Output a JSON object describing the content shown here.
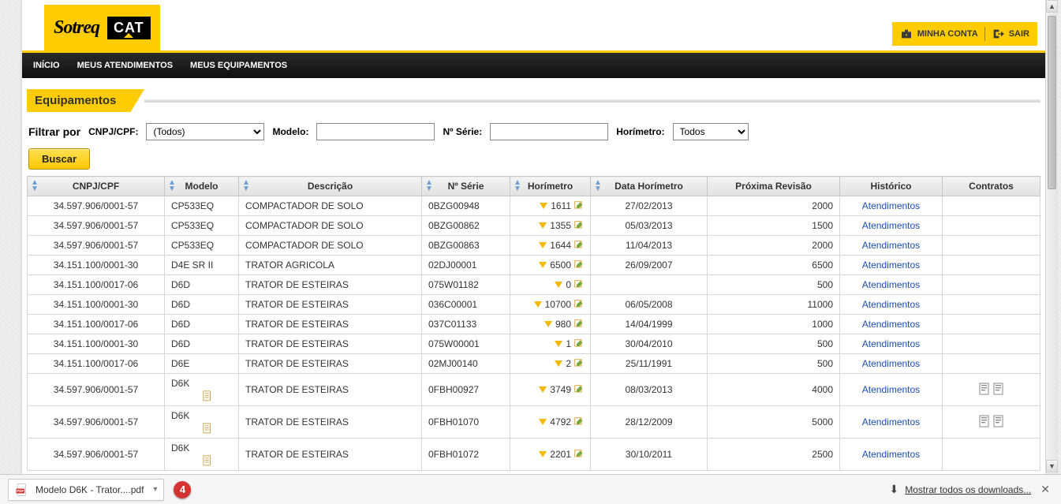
{
  "brand": {
    "name": "Sotreq",
    "partner": "CAT"
  },
  "account": {
    "my_account": "MINHA CONTA",
    "logout": "SAIR"
  },
  "nav": {
    "home": "INÍCIO",
    "atend": "MEUS ATENDIMENTOS",
    "equip": "MEUS EQUIPAMENTOS"
  },
  "section_title": "Equipamentos",
  "filters": {
    "filter_by": "Filtrar por",
    "cnpj_label": "CNPJ/CPF:",
    "cnpj_value": "(Todos)",
    "modelo_label": "Modelo:",
    "modelo_value": "",
    "serie_label": "Nº Série:",
    "serie_value": "",
    "hori_label": "Horímetro:",
    "hori_value": "Todos",
    "buscar": "Buscar"
  },
  "columns": {
    "cnpj": "CNPJ/CPF",
    "modelo": "Modelo",
    "descricao": "Descrição",
    "serie": "Nº Série",
    "horimetro": "Horímetro",
    "data_hori": "Data Horímetro",
    "prox_rev": "Próxima Revisão",
    "historico": "Histórico",
    "contratos": "Contratos"
  },
  "link_label": "Atendimentos",
  "rows": [
    {
      "cnpj": "34.597.906/0001-57",
      "modelo": "CP533EQ",
      "desc": "COMPACTADOR DE SOLO",
      "serie": "0BZG00948",
      "hori": "1611",
      "data": "27/02/2013",
      "prox": "2000",
      "hist": true,
      "contr": false,
      "tall": false,
      "doc": false
    },
    {
      "cnpj": "34.597.906/0001-57",
      "modelo": "CP533EQ",
      "desc": "COMPACTADOR DE SOLO",
      "serie": "0BZG00862",
      "hori": "1355",
      "data": "05/03/2013",
      "prox": "1500",
      "hist": true,
      "contr": false,
      "tall": false,
      "doc": false
    },
    {
      "cnpj": "34.597.906/0001-57",
      "modelo": "CP533EQ",
      "desc": "COMPACTADOR DE SOLO",
      "serie": "0BZG00863",
      "hori": "1644",
      "data": "11/04/2013",
      "prox": "2000",
      "hist": true,
      "contr": false,
      "tall": false,
      "doc": false
    },
    {
      "cnpj": "34.151.100/0001-30",
      "modelo": "D4E SR II",
      "desc": "TRATOR AGRICOLA",
      "serie": "02DJ00001",
      "hori": "6500",
      "data": "26/09/2007",
      "prox": "6500",
      "hist": true,
      "contr": false,
      "tall": false,
      "doc": false
    },
    {
      "cnpj": "34.151.100/0017-06",
      "modelo": "D6D",
      "desc": "TRATOR DE ESTEIRAS",
      "serie": "075W01182",
      "hori": "0",
      "data": "",
      "prox": "500",
      "hist": true,
      "contr": false,
      "tall": false,
      "doc": false
    },
    {
      "cnpj": "34.151.100/0001-30",
      "modelo": "D6D",
      "desc": "TRATOR DE ESTEIRAS",
      "serie": "036C00001",
      "hori": "10700",
      "data": "06/05/2008",
      "prox": "11000",
      "hist": true,
      "contr": false,
      "tall": false,
      "doc": false
    },
    {
      "cnpj": "34.151.100/0017-06",
      "modelo": "D6D",
      "desc": "TRATOR DE ESTEIRAS",
      "serie": "037C01133",
      "hori": "980",
      "data": "14/04/1999",
      "prox": "1000",
      "hist": true,
      "contr": false,
      "tall": false,
      "doc": false
    },
    {
      "cnpj": "34.151.100/0001-30",
      "modelo": "D6D",
      "desc": "TRATOR DE ESTEIRAS",
      "serie": "075W00001",
      "hori": "1",
      "data": "30/04/2010",
      "prox": "500",
      "hist": true,
      "contr": false,
      "tall": false,
      "doc": false
    },
    {
      "cnpj": "34.151.100/0017-06",
      "modelo": "D6E",
      "desc": "TRATOR DE ESTEIRAS",
      "serie": "02MJ00140",
      "hori": "2",
      "data": "25/11/1991",
      "prox": "500",
      "hist": true,
      "contr": false,
      "tall": false,
      "doc": false
    },
    {
      "cnpj": "34.597.906/0001-57",
      "modelo": "D6K",
      "desc": "TRATOR DE ESTEIRAS",
      "serie": "0FBH00927",
      "hori": "3749",
      "data": "08/03/2013",
      "prox": "4000",
      "hist": true,
      "contr": true,
      "tall": true,
      "doc": true
    },
    {
      "cnpj": "34.597.906/0001-57",
      "modelo": "D6K",
      "desc": "TRATOR DE ESTEIRAS",
      "serie": "0FBH01070",
      "hori": "4792",
      "data": "28/12/2009",
      "prox": "5000",
      "hist": true,
      "contr": true,
      "tall": true,
      "doc": true
    },
    {
      "cnpj": "34.597.906/0001-57",
      "modelo": "D6K",
      "desc": "TRATOR DE ESTEIRAS",
      "serie": "0FBH01072",
      "hori": "2201",
      "data": "30/10/2011",
      "prox": "2500",
      "hist": true,
      "contr": false,
      "tall": true,
      "doc": true
    }
  ],
  "download": {
    "filename": "Modelo D6K - Trator....pdf",
    "badge": "4",
    "show_all": "Mostrar todos os downloads..."
  }
}
